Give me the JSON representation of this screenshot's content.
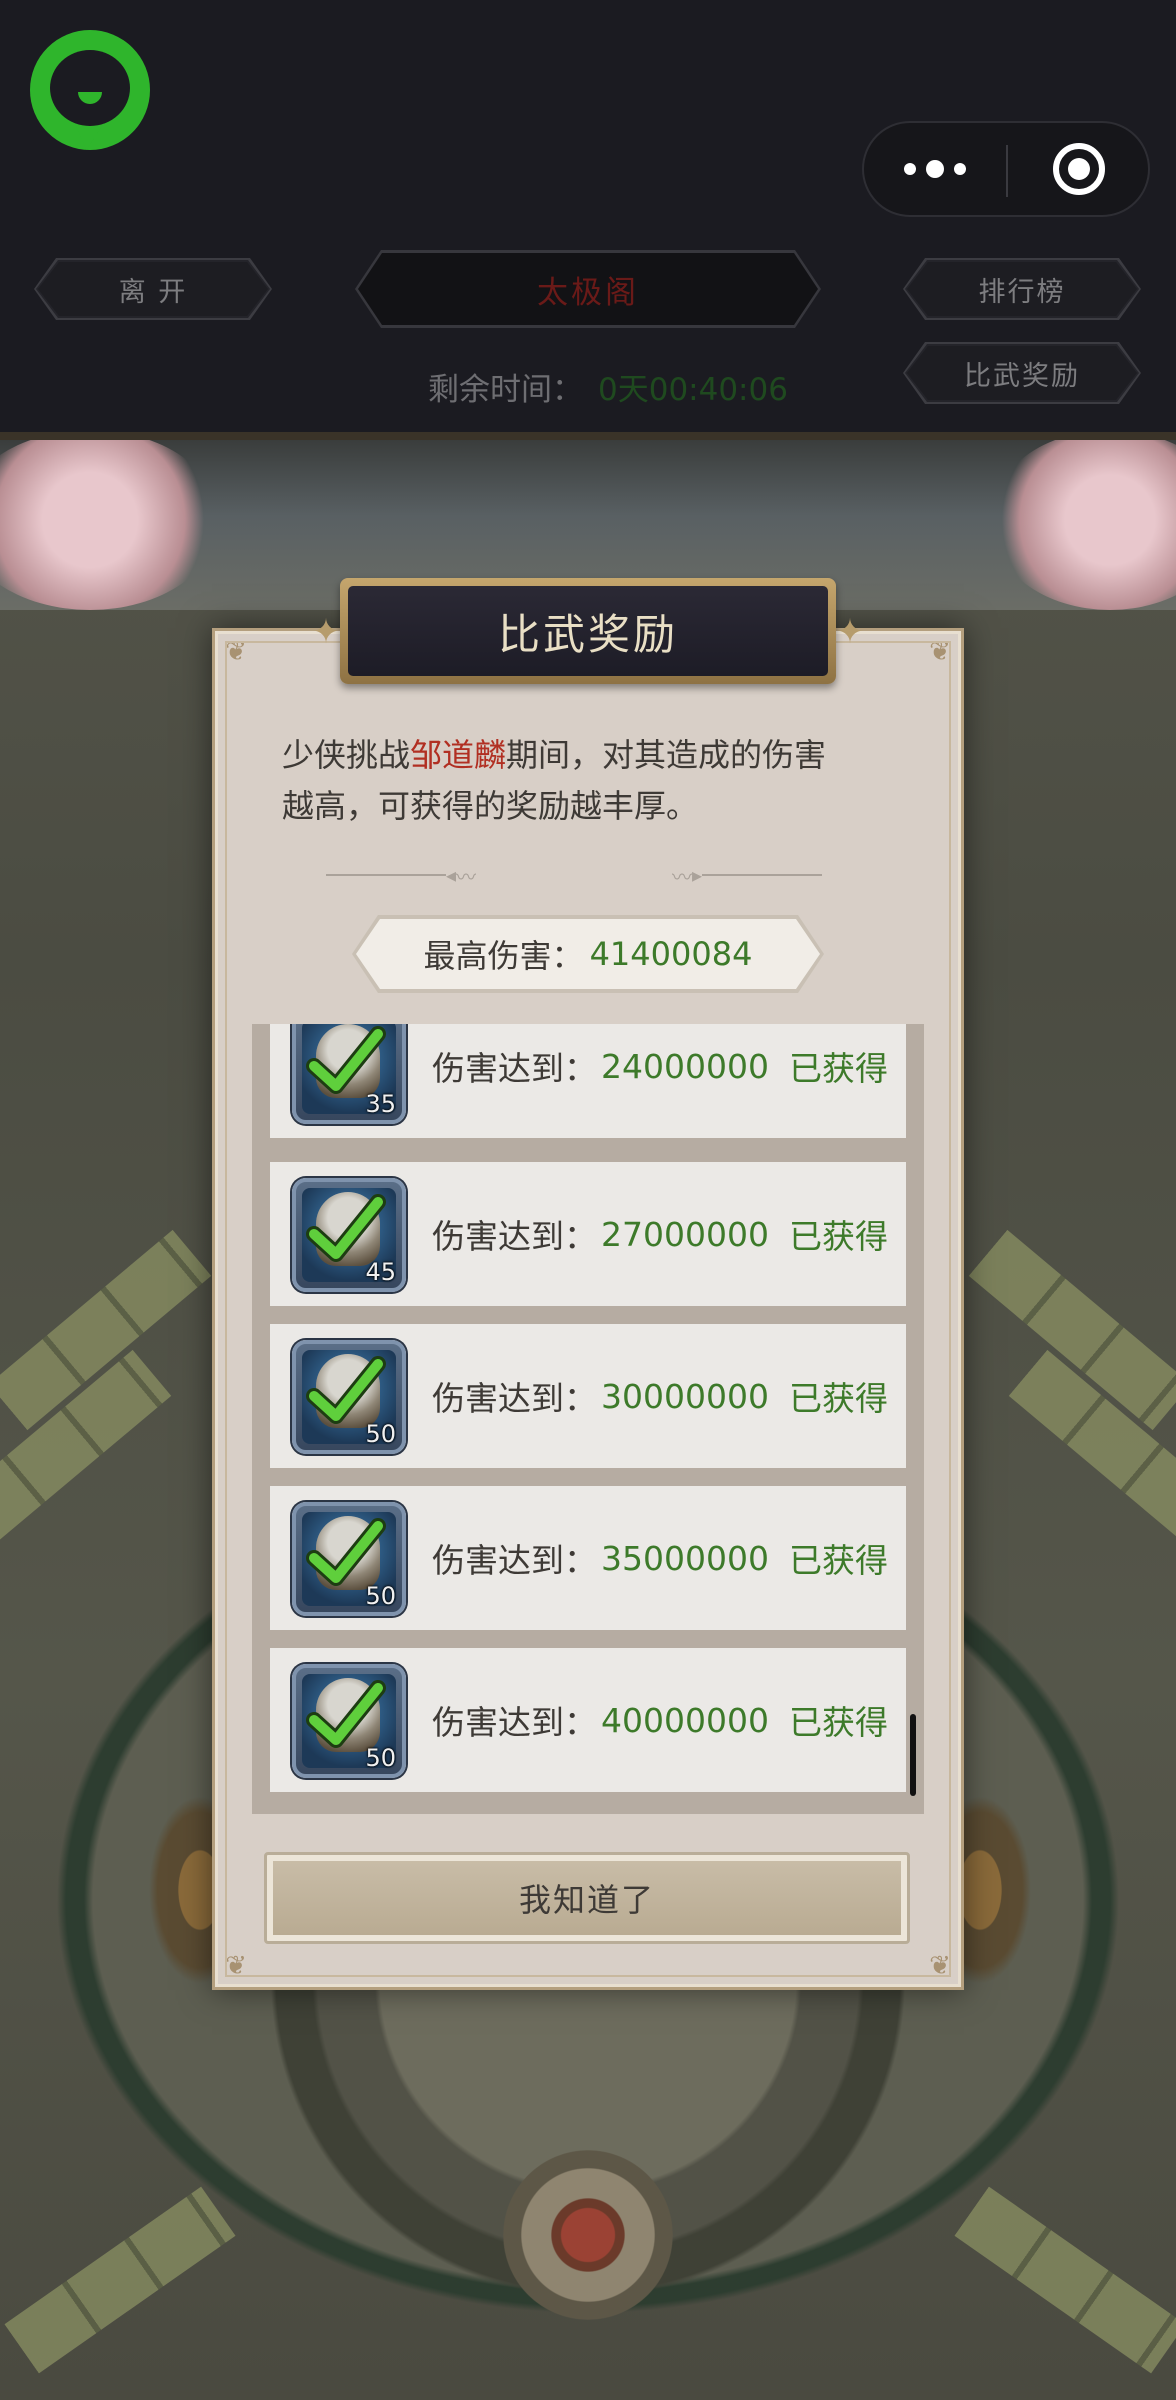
{
  "header": {
    "leave_label": "离 开",
    "title": "太极阁",
    "ranking_label": "排行榜",
    "rewards_label": "比武奖励",
    "timer_label": "剩余时间：",
    "timer_value": "0天00:40:06"
  },
  "capsule": {
    "more_icon": "more-dots-icon",
    "close_icon": "target-ring-icon"
  },
  "modal": {
    "title": "比武奖励",
    "desc_prefix": "少侠挑战",
    "desc_boss": "邹道麟",
    "desc_suffix_line1": "期间，对其造成的伤害",
    "desc_line2": "越高，可获得的奖励越丰厚。",
    "max_damage_label": "最高伤害：",
    "max_damage_value": "41400084",
    "rows": [
      {
        "label": "伤害达到：",
        "value": "24000000",
        "status": "已获得",
        "count": "35"
      },
      {
        "label": "伤害达到：",
        "value": "27000000",
        "status": "已获得",
        "count": "45"
      },
      {
        "label": "伤害达到：",
        "value": "30000000",
        "status": "已获得",
        "count": "50"
      },
      {
        "label": "伤害达到：",
        "value": "35000000",
        "status": "已获得",
        "count": "50"
      },
      {
        "label": "伤害达到：",
        "value": "40000000",
        "status": "已获得",
        "count": "50"
      }
    ],
    "confirm_label": "我知道了"
  },
  "colors": {
    "accent_green": "#3d7a2a",
    "boss_red": "#b12f22",
    "logo_green": "#2fb52c"
  }
}
